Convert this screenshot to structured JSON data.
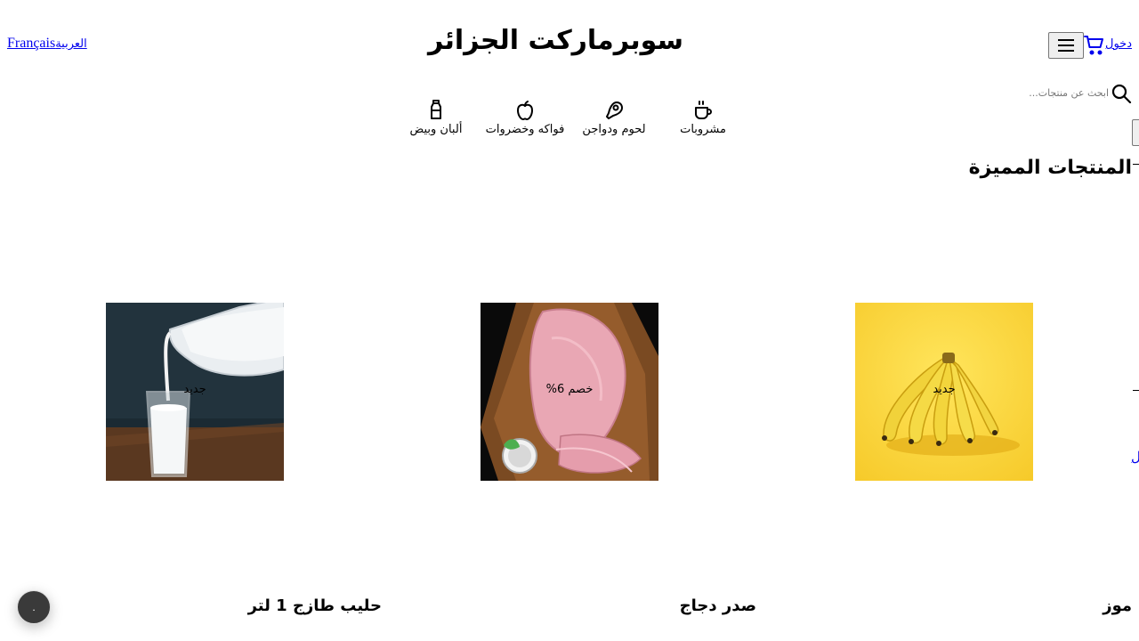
{
  "header": {
    "site_title": "سوبرماركت الجزائر",
    "lang_arabic": "العربية",
    "lang_french": "Français",
    "login_label": "دخول"
  },
  "search": {
    "placeholder": "ابحث عن منتجات..."
  },
  "categories": [
    {
      "label": "مشروبات",
      "icon": "coffee-cup-icon"
    },
    {
      "label": "لحوم ودواجن",
      "icon": "meat-icon"
    },
    {
      "label": "فواكه وخضروات",
      "icon": "apple-icon"
    },
    {
      "label": "ألبان وبيض",
      "icon": "milk-bottle-icon"
    }
  ],
  "featured": {
    "title": "المنتجات المميزة",
    "view_all": "ل",
    "products": [
      {
        "name": "موز",
        "badge": "جديد"
      },
      {
        "name": "صدر دجاج",
        "badge": "خصم 6%"
      },
      {
        "name": "حليب طازج 1 لتر",
        "badge": "جديد"
      }
    ]
  },
  "chat": {
    "label": "."
  },
  "colors": {
    "link": "#0000ee",
    "chat_bg": "#3a3a3a"
  }
}
